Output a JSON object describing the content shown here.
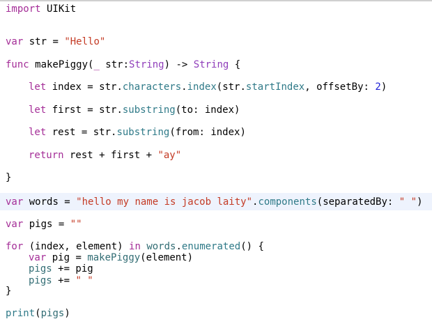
{
  "colors": {
    "keyword": "#a42d97",
    "string": "#c43a24",
    "type": "#8f3dba",
    "function": "#2f7a88",
    "number": "#1f20d5",
    "background": "#ffffff",
    "current_line": "#eef3fd"
  },
  "code": {
    "l1": {
      "kw": "import",
      "rest": " UIKit"
    },
    "l2": {
      "kw": "var",
      "name": " str = ",
      "str": "\"Hello\""
    },
    "l3": {
      "kw": "func",
      "a": " makePiggy(",
      "kw2": "_",
      "b": " str:",
      "typ": "String",
      "c": ") -> ",
      "typ2": "String",
      "d": " {"
    },
    "l4": {
      "kw": "let",
      "a": " index = str.",
      "fn1": "characters",
      "b": ".",
      "fn2": "index",
      "c": "(str.",
      "fn3": "startIndex",
      "d": ", offsetBy: ",
      "num": "2",
      "e": ")"
    },
    "l5": {
      "kw": "let",
      "a": " first = str.",
      "fn1": "substring",
      "b": "(to: index)"
    },
    "l6": {
      "kw": "let",
      "a": " rest = str.",
      "fn1": "substring",
      "b": "(from: index)"
    },
    "l7": {
      "kw": "return",
      "a": " rest + first + ",
      "str": "\"ay\""
    },
    "l8": {
      "a": "}"
    },
    "l9": {
      "kw": "var",
      "a": " words = ",
      "str": "\"hello my name is jacob laity\"",
      "b": ".",
      "fn1": "components",
      "c": "(separatedBy: ",
      "str2": "\" \"",
      "d": ")"
    },
    "l10": {
      "kw": "var",
      "a": " pigs = ",
      "str": "\"\""
    },
    "l11": {
      "kw": "for",
      "a": " (index, element) ",
      "kw2": "in",
      "b": " ",
      "v1": "words",
      "c": ".",
      "fn1": "enumerated",
      "d": "() {"
    },
    "l12": {
      "kw": "var",
      "a": " pig = ",
      "v1": "makePiggy",
      "b": "(element)"
    },
    "l13": {
      "v1": "pigs",
      "a": " += pig"
    },
    "l14": {
      "v1": "pigs",
      "a": " += ",
      "str": "\" \""
    },
    "l15": {
      "a": "}"
    },
    "l16": {
      "fn1": "print",
      "a": "(",
      "v1": "pigs",
      "b": ")"
    }
  }
}
